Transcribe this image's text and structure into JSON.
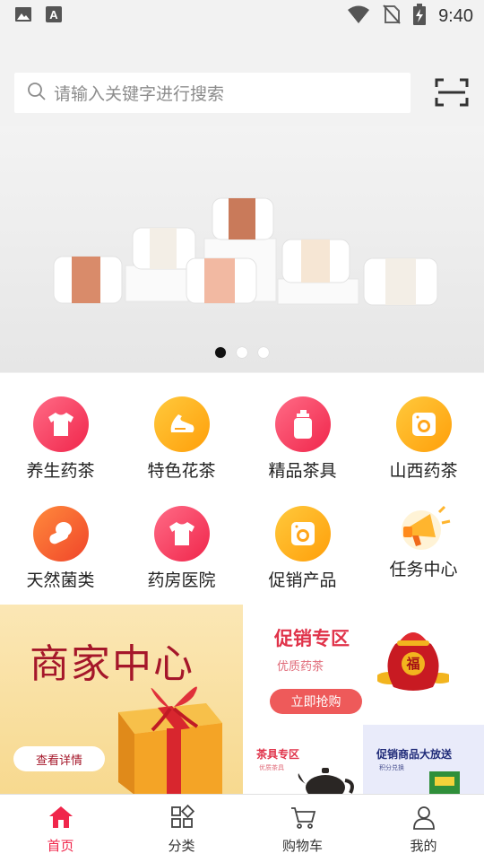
{
  "status_bar": {
    "time": "9:40"
  },
  "search": {
    "placeholder": "请输入关键字进行搜索"
  },
  "banner": {
    "slide_count": 3,
    "active_slide": 1
  },
  "categories": [
    {
      "label": "养生药茶",
      "icon": "tshirt-icon",
      "color": "#f0264b"
    },
    {
      "label": "特色花茶",
      "icon": "sneaker-icon",
      "color": "#ffa51a"
    },
    {
      "label": "精品茶具",
      "icon": "bottle-icon",
      "color": "#f0264b"
    },
    {
      "label": "山西药茶",
      "icon": "washer-icon",
      "color": "#ffa51a"
    },
    {
      "label": "天然菌类",
      "icon": "vegetable-icon",
      "color": "#f0452a"
    },
    {
      "label": "药房医院",
      "icon": "tshirt-icon",
      "color": "#f0264b"
    },
    {
      "label": "促销产品",
      "icon": "washer-icon",
      "color": "#ffa51a"
    },
    {
      "label": "任务中心",
      "icon": "megaphone-icon",
      "color": "#ffb52e"
    }
  ],
  "promos": {
    "merchant": {
      "title": "商家中心",
      "button": "查看详情"
    },
    "sale": {
      "title": "促销专区",
      "subtitle": "优质药茶",
      "button": "立即抢购",
      "bag_text": "福"
    },
    "tea_set": {
      "title": "茶具专区",
      "subtitle": "优质茶具"
    },
    "giveaway": {
      "title": "促销商品大放送",
      "subtitle": "积分兑换"
    }
  },
  "nav": [
    {
      "label": "首页",
      "icon": "home-icon",
      "active": true
    },
    {
      "label": "分类",
      "icon": "grid-icon",
      "active": false
    },
    {
      "label": "购物车",
      "icon": "cart-icon",
      "active": false
    },
    {
      "label": "我的",
      "icon": "user-icon",
      "active": false
    }
  ],
  "colors": {
    "accent": "#f0264b",
    "orange": "#ffa51a",
    "background": "#f2f2f2"
  }
}
